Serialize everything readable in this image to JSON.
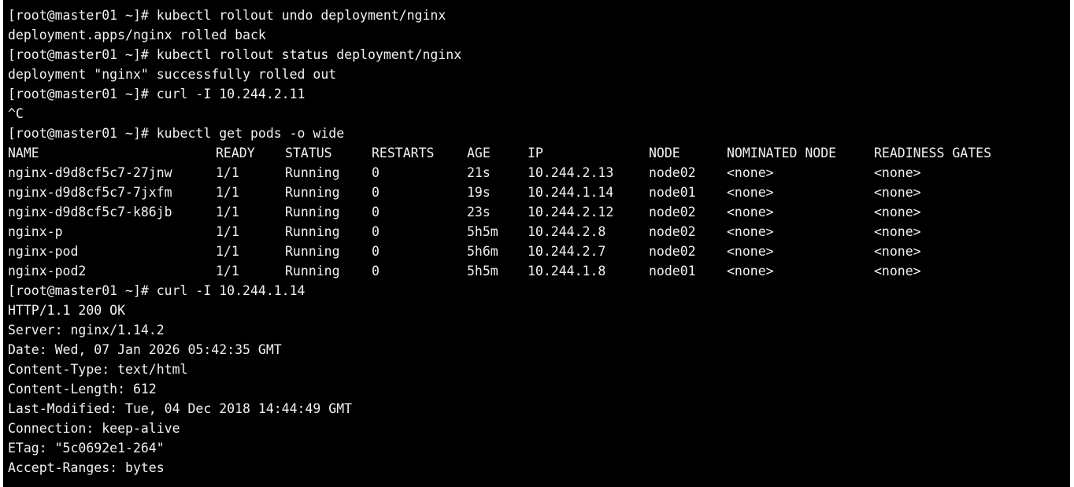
{
  "terminal": {
    "lines_before": [
      "[root@master01 ~]# kubectl rollout undo deployment/nginx",
      "deployment.apps/nginx rolled back",
      "[root@master01 ~]# kubectl rollout status deployment/nginx",
      "deployment \"nginx\" successfully rolled out",
      "[root@master01 ~]# curl -I 10.244.2.11",
      "^C",
      "[root@master01 ~]# kubectl get pods -o wide"
    ],
    "pods_table": {
      "headers": [
        "NAME",
        "READY",
        "STATUS",
        "RESTARTS",
        "AGE",
        "IP",
        "NODE",
        "NOMINATED NODE",
        "READINESS GATES"
      ],
      "rows": [
        [
          "nginx-d9d8cf5c7-27jnw",
          "1/1",
          "Running",
          "0",
          "21s",
          "10.244.2.13",
          "node02",
          "<none>",
          "<none>"
        ],
        [
          "nginx-d9d8cf5c7-7jxfm",
          "1/1",
          "Running",
          "0",
          "19s",
          "10.244.1.14",
          "node01",
          "<none>",
          "<none>"
        ],
        [
          "nginx-d9d8cf5c7-k86jb",
          "1/1",
          "Running",
          "0",
          "23s",
          "10.244.2.12",
          "node02",
          "<none>",
          "<none>"
        ],
        [
          "nginx-p",
          "1/1",
          "Running",
          "0",
          "5h5m",
          "10.244.2.8",
          "node02",
          "<none>",
          "<none>"
        ],
        [
          "nginx-pod",
          "1/1",
          "Running",
          "0",
          "5h6m",
          "10.244.2.7",
          "node02",
          "<none>",
          "<none>"
        ],
        [
          "nginx-pod2",
          "1/1",
          "Running",
          "0",
          "5h5m",
          "10.244.1.8",
          "node01",
          "<none>",
          "<none>"
        ]
      ]
    },
    "lines_after": [
      "[root@master01 ~]# curl -I 10.244.1.14",
      "HTTP/1.1 200 OK",
      "Server: nginx/1.14.2",
      "Date: Wed, 07 Jan 2026 05:42:35 GMT",
      "Content-Type: text/html",
      "Content-Length: 612",
      "Last-Modified: Tue, 04 Dec 2018 14:44:49 GMT",
      "Connection: keep-alive",
      "ETag: \"5c0692e1-264\"",
      "Accept-Ranges: bytes"
    ]
  }
}
